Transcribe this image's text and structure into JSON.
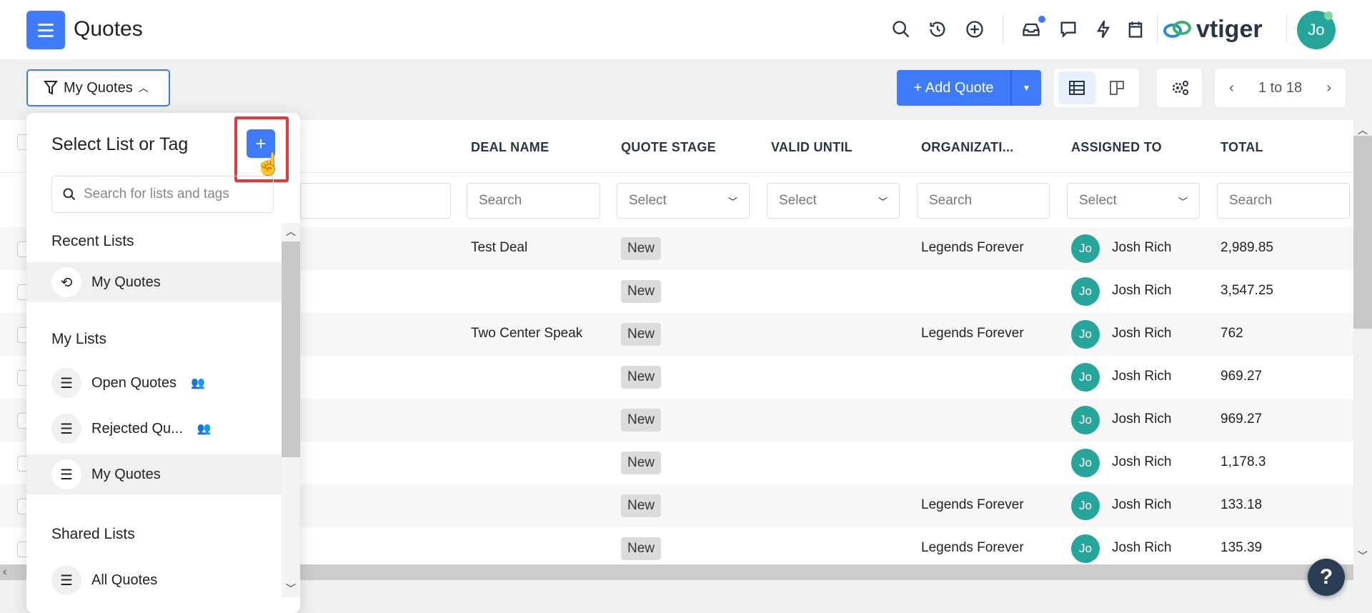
{
  "header": {
    "title": "Quotes",
    "logo": "vtiger",
    "avatar": "Jo",
    "icons": [
      "search-icon",
      "history-icon",
      "add-circle-icon",
      "inbox-icon",
      "chat-icon",
      "bolt-icon",
      "calendar-icon"
    ]
  },
  "toolbar": {
    "filter_label": "My Quotes",
    "add_label": "+ Add Quote",
    "pager": "1 to 18"
  },
  "table": {
    "columns": [
      "DEAL NAME",
      "QUOTE STAGE",
      "VALID UNTIL",
      "ORGANIZATI...",
      "ASSIGNED TO",
      "TOTAL"
    ],
    "filters": [
      "Search",
      "Select",
      "Select",
      "Search",
      "Select",
      "Search"
    ],
    "rows": [
      {
        "deal": "Test Deal",
        "stage": "New",
        "org": "Legends Forever",
        "avatar": "Jo",
        "assigned": "Josh Rich",
        "total": "2,989.85"
      },
      {
        "deal": "",
        "stage": "New",
        "org": "",
        "avatar": "Jo",
        "assigned": "Josh Rich",
        "total": "3,547.25"
      },
      {
        "deal": "Two Center Speak",
        "stage": "New",
        "org": "Legends Forever",
        "avatar": "Jo",
        "assigned": "Josh Rich",
        "total": "762"
      },
      {
        "deal": "",
        "stage": "New",
        "org": "",
        "avatar": "Jo",
        "assigned": "Josh Rich",
        "total": "969.27"
      },
      {
        "deal": "",
        "stage": "New",
        "org": "",
        "avatar": "Jo",
        "assigned": "Josh Rich",
        "total": "969.27"
      },
      {
        "deal": "",
        "stage": "New",
        "org": "",
        "avatar": "Jo",
        "assigned": "Josh Rich",
        "total": "1,178.3"
      },
      {
        "deal": "",
        "stage": "New",
        "org": "Legends Forever",
        "avatar": "Jo",
        "assigned": "Josh Rich",
        "total": "133.18"
      },
      {
        "deal": "",
        "stage": "New",
        "org": "Legends Forever",
        "avatar": "Jo",
        "assigned": "Josh Rich",
        "total": "135.39"
      }
    ]
  },
  "popup": {
    "title": "Select List or Tag",
    "search_placeholder": "Search for lists and tags",
    "recent_label": "Recent Lists",
    "recent": [
      {
        "label": "My Quotes"
      }
    ],
    "my_label": "My Lists",
    "my": [
      {
        "label": "Open Quotes",
        "shared": true
      },
      {
        "label": "Rejected Qu...",
        "shared": true
      },
      {
        "label": "My Quotes",
        "shared": false
      }
    ],
    "shared_label": "Shared Lists",
    "shared": [
      {
        "label": "All Quotes"
      }
    ]
  },
  "help": "?"
}
